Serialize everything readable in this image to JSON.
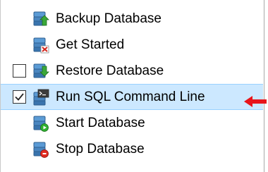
{
  "tree": {
    "items": [
      {
        "label": "Backup Database",
        "icon": "backup-database-icon",
        "checkbox": null
      },
      {
        "label": "Get Started",
        "icon": "get-started-icon",
        "checkbox": null
      },
      {
        "label": "Restore Database",
        "icon": "restore-database-icon",
        "checkbox": "unchecked"
      },
      {
        "label": "Run SQL Command Line",
        "icon": "run-sql-command-line-icon",
        "checkbox": "checked",
        "selected": true
      },
      {
        "label": "Start Database",
        "icon": "start-database-icon",
        "checkbox": null
      },
      {
        "label": "Stop Database",
        "icon": "stop-database-icon",
        "checkbox": null
      }
    ]
  },
  "colors": {
    "selection_background": "#cce8ff",
    "selection_border": "#99d1ff",
    "arrow": "#e8141a"
  }
}
